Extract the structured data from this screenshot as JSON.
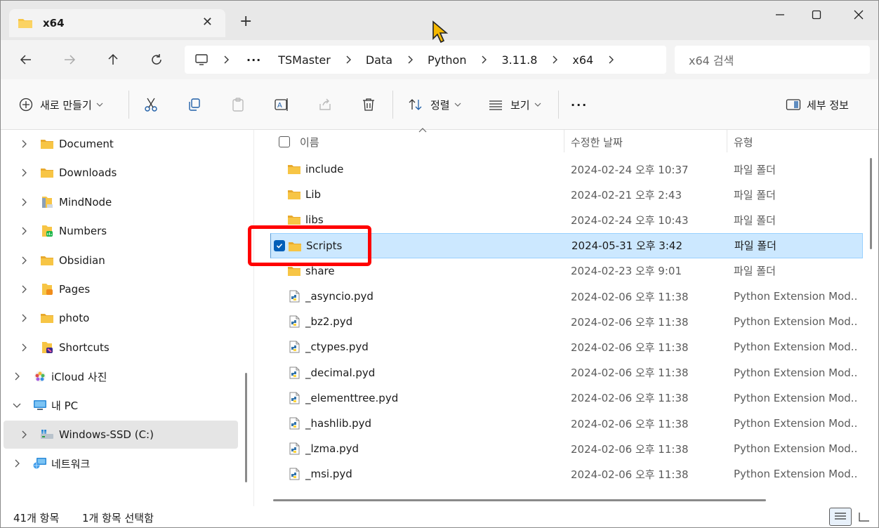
{
  "tab": {
    "title": "x64",
    "close": "✕",
    "new": "+"
  },
  "window_controls": {
    "minimize": "—",
    "maximize": "☐",
    "close": "✕"
  },
  "breadcrumb": {
    "more": "···",
    "items": [
      "TSMaster",
      "Data",
      "Python",
      "3.11.8",
      "x64"
    ]
  },
  "search": {
    "placeholder": "x64 검색"
  },
  "commands": {
    "new_label": "새로 만들기",
    "sort_label": "정렬",
    "view_label": "보기",
    "more_label": "···",
    "details_label": "세부 정보"
  },
  "sidebar": {
    "items": [
      {
        "label": "Document",
        "icon": "folder-icon"
      },
      {
        "label": "Downloads",
        "icon": "folder-icon"
      },
      {
        "label": "MindNode",
        "icon": "mindnode-folder-icon"
      },
      {
        "label": "Numbers",
        "icon": "numbers-folder-icon"
      },
      {
        "label": "Obsidian",
        "icon": "folder-icon"
      },
      {
        "label": "Pages",
        "icon": "pages-folder-icon"
      },
      {
        "label": "photo",
        "icon": "folder-icon"
      },
      {
        "label": "Shortcuts",
        "icon": "shortcuts-folder-icon"
      },
      {
        "label": "iCloud 사진",
        "icon": "icloud-photos-icon"
      },
      {
        "label": "내 PC",
        "icon": "pc-icon"
      },
      {
        "label": "Windows-SSD (C:)",
        "icon": "drive-icon"
      },
      {
        "label": "네트워크",
        "icon": "network-icon"
      }
    ]
  },
  "columns": {
    "name": "이름",
    "date": "수정한 날짜",
    "type": "유형"
  },
  "files": [
    {
      "name": "include",
      "date": "2024-02-24 오후 10:37",
      "type": "파일 폴더",
      "kind": "folder"
    },
    {
      "name": "Lib",
      "date": "2024-02-21 오후 2:43",
      "type": "파일 폴더",
      "kind": "folder"
    },
    {
      "name": "libs",
      "date": "2024-02-24 오후 10:43",
      "type": "파일 폴더",
      "kind": "folder"
    },
    {
      "name": "Scripts",
      "date": "2024-05-31 오후 3:42",
      "type": "파일 폴더",
      "kind": "folder",
      "selected": true
    },
    {
      "name": "share",
      "date": "2024-02-23 오후 9:01",
      "type": "파일 폴더",
      "kind": "folder"
    },
    {
      "name": "_asyncio.pyd",
      "date": "2024-02-06 오후 11:38",
      "type": "Python Extension Mod...",
      "kind": "pyd"
    },
    {
      "name": "_bz2.pyd",
      "date": "2024-02-06 오후 11:38",
      "type": "Python Extension Mod...",
      "kind": "pyd"
    },
    {
      "name": "_ctypes.pyd",
      "date": "2024-02-06 오후 11:38",
      "type": "Python Extension Mod...",
      "kind": "pyd"
    },
    {
      "name": "_decimal.pyd",
      "date": "2024-02-06 오후 11:38",
      "type": "Python Extension Mod...",
      "kind": "pyd"
    },
    {
      "name": "_elementtree.pyd",
      "date": "2024-02-06 오후 11:38",
      "type": "Python Extension Mod...",
      "kind": "pyd"
    },
    {
      "name": "_hashlib.pyd",
      "date": "2024-02-06 오후 11:38",
      "type": "Python Extension Mod...",
      "kind": "pyd"
    },
    {
      "name": "_lzma.pyd",
      "date": "2024-02-06 오후 11:38",
      "type": "Python Extension Mod...",
      "kind": "pyd"
    },
    {
      "name": "_msi.pyd",
      "date": "2024-02-06 오후 11:38",
      "type": "Python Extension Mod...",
      "kind": "pyd"
    }
  ],
  "status": {
    "count": "41개 항목",
    "selection": "1개 항목 선택함"
  },
  "colors": {
    "folder": "#f7c545",
    "accent": "#005fb8",
    "selection": "#cce8ff",
    "highlight": "#ff0000"
  }
}
